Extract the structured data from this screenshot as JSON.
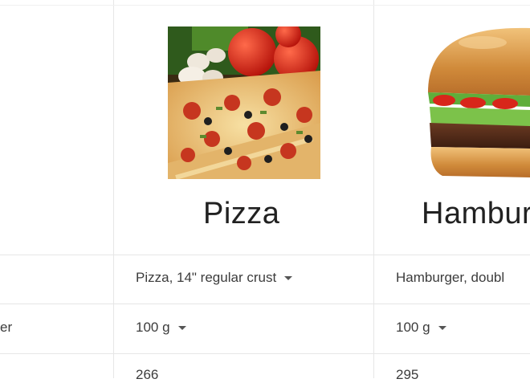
{
  "columns": [
    {
      "name": "Pizza",
      "image_icon": "pizza-photo",
      "variant_label": "Pizza, 14\" regular crust",
      "amount_label": "100 g",
      "calories": "266"
    },
    {
      "name": "Hambur",
      "image_icon": "hamburger-photo",
      "variant_label": "Hamburger, doubl",
      "amount_label": "100 g",
      "calories": "295"
    }
  ],
  "left_row_label_fragment": "er"
}
